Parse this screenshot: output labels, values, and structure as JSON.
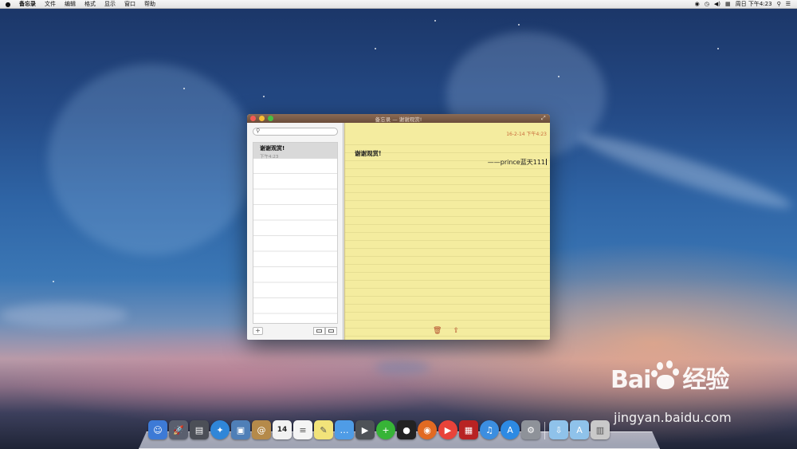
{
  "menubar": {
    "apple_icon": "apple-icon",
    "app_name": "备忘录",
    "menus": [
      "文件",
      "编辑",
      "格式",
      "显示",
      "窗口",
      "帮助"
    ],
    "status_icons": [
      "qq-status-icon",
      "time-machine-icon",
      "volume-icon",
      "input-method-icon"
    ],
    "clock": "周日 下午4:23",
    "spotlight_icon": "spotlight-icon",
    "notification_icon": "notification-center-icon"
  },
  "window": {
    "title": "备忘录 — 谢谢观赏!",
    "sidebar": {
      "search_placeholder": "",
      "notes": [
        {
          "title": "谢谢观赏!",
          "time": "下午4:23"
        }
      ],
      "add_label": "+"
    },
    "note": {
      "date": "16-2-14 下午4:23",
      "line1": "谢谢观赏!",
      "line2": "——prince蓝天111"
    }
  },
  "dock": {
    "apps": [
      {
        "name": "finder",
        "color": "#3d7ad6"
      },
      {
        "name": "launchpad",
        "color": "#5a5f6e"
      },
      {
        "name": "mission-control",
        "color": "#4c4f57"
      },
      {
        "name": "safari",
        "color": "#2f86d8"
      },
      {
        "name": "preview",
        "color": "#4f7fb7"
      },
      {
        "name": "contacts",
        "color": "#b58a4a"
      },
      {
        "name": "calendar",
        "color": "#f2f2f2",
        "day": "14"
      },
      {
        "name": "reminders",
        "color": "#f4f4f4"
      },
      {
        "name": "notes",
        "color": "#f2e37a"
      },
      {
        "name": "messages",
        "color": "#4f9ce6"
      },
      {
        "name": "facetime",
        "color": "#4e5257"
      },
      {
        "name": "app-store-plus",
        "color": "#37b437"
      },
      {
        "name": "qq",
        "color": "#222222"
      },
      {
        "name": "firefox",
        "color": "#e16a22"
      },
      {
        "name": "video-player",
        "color": "#e8433a"
      },
      {
        "name": "photo-booth",
        "color": "#b82323"
      },
      {
        "name": "itunes",
        "color": "#3c8ee0"
      },
      {
        "name": "app-store",
        "color": "#2d8ae3"
      },
      {
        "name": "system-preferences",
        "color": "#8e9299"
      }
    ],
    "stacks": [
      {
        "name": "downloads-folder",
        "color": "#8fc2ea"
      },
      {
        "name": "applications-folder",
        "color": "#8fc2ea"
      },
      {
        "name": "trash",
        "color": "#c9c9c9"
      }
    ]
  },
  "watermark": {
    "logo_text_1": "Bai",
    "logo_text_2": "经验",
    "url": "jingyan.baidu.com"
  }
}
